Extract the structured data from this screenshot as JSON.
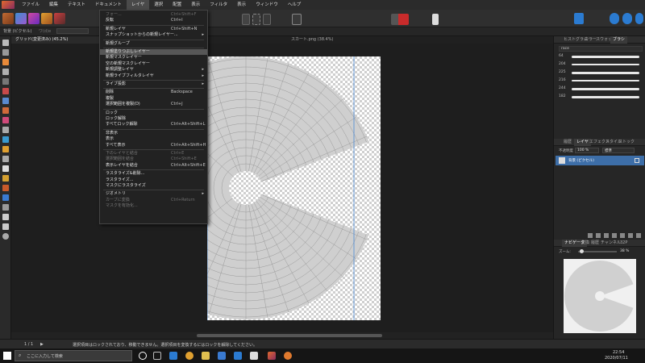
{
  "menubar": {
    "items": [
      "ファイル",
      "編集",
      "テキスト",
      "ドキュメント",
      "レイヤ",
      "選択",
      "配置",
      "表示",
      "フィルタ",
      "表示",
      "ウィンドウ",
      "ヘルプ"
    ],
    "active_index": 4
  },
  "context_bar": {
    "label": "背景 (ピクセル)",
    "extra": "ワ(d)e"
  },
  "tabs": [
    {
      "label": "グリッド(変更済み) (45.2%)",
      "active": true
    },
    {
      "label": "スカート.png (38.4%)",
      "active": false
    }
  ],
  "menu": {
    "items": [
      {
        "label": "フォー...",
        "shortcut": "Ctrl+Shift+F",
        "disabled": true
      },
      {
        "label": "反転",
        "shortcut": "Ctrl+I"
      },
      {
        "sep": true
      },
      {
        "label": "新規レイヤ",
        "shortcut": "Ctrl+Shift+N"
      },
      {
        "label": "スナップショットからの新規レイヤー...",
        "arrow": "▸"
      },
      {
        "sep": true
      },
      {
        "label": "新規グループ"
      },
      {
        "sep": true
      },
      {
        "label": "新規塗りつぶしレイヤー",
        "highlight": true
      },
      {
        "label": "新規マスクレイヤー"
      },
      {
        "label": "空の新規マスクレイヤー"
      },
      {
        "label": "新規調整レイヤ",
        "arrow": "▸"
      },
      {
        "label": "新規ライブフィルタレイヤ",
        "arrow": "▸"
      },
      {
        "sep": true
      },
      {
        "label": "ライブ投影",
        "arrow": "▸"
      },
      {
        "sep": true
      },
      {
        "label": "削除",
        "shortcut": "Backspace"
      },
      {
        "label": "複製"
      },
      {
        "label": "選択範囲を複製(D)",
        "shortcut": "Ctrl+J"
      },
      {
        "sep": true
      },
      {
        "label": "ロック"
      },
      {
        "label": "ロック解除"
      },
      {
        "label": "すべてロック解除",
        "shortcut": "Ctrl+Alt+Shift+L"
      },
      {
        "sep": true
      },
      {
        "label": "非表示"
      },
      {
        "label": "表示"
      },
      {
        "label": "すべて表示",
        "shortcut": "Ctrl+Alt+Shift+H"
      },
      {
        "sep": true
      },
      {
        "label": "下のレイヤと結合",
        "shortcut": "Ctrl+E",
        "disabled": true
      },
      {
        "label": "選択範囲を結合",
        "shortcut": "Ctrl+Shift+E",
        "disabled": true
      },
      {
        "label": "表示レイヤを結合",
        "shortcut": "Ctrl+Alt+Shift+E"
      },
      {
        "sep": true
      },
      {
        "label": "ラスタライズ&削除..."
      },
      {
        "label": "ラスタライズ..."
      },
      {
        "label": "マスクにラスタライズ"
      },
      {
        "sep": true
      },
      {
        "label": "ジオメトリ",
        "arrow": "▸"
      },
      {
        "label": "カーブに変換",
        "shortcut": "Ctrl+Return",
        "disabled": true
      },
      {
        "label": "マスクを有効化...",
        "disabled": true
      }
    ]
  },
  "right_panel": {
    "top_tabs": [
      "ヒストグラム",
      "カラー",
      "スウォッチ",
      "ブラシ"
    ],
    "brush_category": "race",
    "brush_sizes": [
      "64",
      "204",
      "225",
      "216",
      "244",
      "182"
    ],
    "layer_tabs": [
      "履歴",
      "レイヤ",
      "エフェクト",
      "スタイル",
      "ストック"
    ],
    "opacity_label": "不透明度",
    "opacity_value": "100 %",
    "blend_mode": "標準",
    "layer_name": "背景 (ピクセル)",
    "nav_tabs": [
      "ナビゲータ",
      "変換",
      "履歴",
      "チャンネル",
      "32P"
    ],
    "zoom_label": "ズーム:",
    "zoom_value": "38 %"
  },
  "status": {
    "page": "1 / 1",
    "message": "選択項目はロックされており、移動できません。選択項目を変換するにはロックを解除してください。"
  },
  "taskbar": {
    "search_placeholder": "ここに入力して検索",
    "time": "22:54",
    "date": "2020/07/11"
  }
}
